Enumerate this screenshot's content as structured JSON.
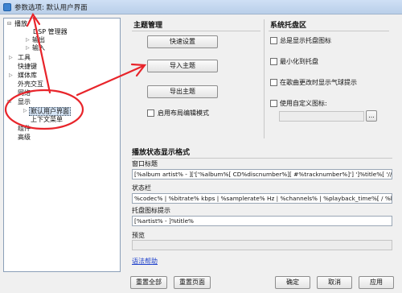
{
  "window": {
    "title": "参数选项: 默认用户界面"
  },
  "tree": {
    "items": [
      {
        "label": "播放",
        "expander": "⊟"
      },
      {
        "label": "DSP 管理器",
        "expander": ""
      },
      {
        "label": "输出",
        "expander": "▷"
      },
      {
        "label": "输入",
        "expander": "▷"
      },
      {
        "label": "工具",
        "expander": "▷"
      },
      {
        "label": "快捷键",
        "expander": ""
      },
      {
        "label": "媒体库",
        "expander": "▷"
      },
      {
        "label": "外壳交互",
        "expander": ""
      },
      {
        "label": "网络",
        "expander": ""
      },
      {
        "label": "显示",
        "expander": "⊟"
      },
      {
        "label": "默认用户界面",
        "expander": "▷"
      },
      {
        "label": "上下文菜单",
        "expander": ""
      },
      {
        "label": "组件",
        "expander": ""
      },
      {
        "label": "高级",
        "expander": ""
      }
    ]
  },
  "theme": {
    "title": "主题管理",
    "quick_setup": "快速设置",
    "import_theme": "导入主题",
    "export_theme": "导出主题",
    "layout_edit_mode": "启用布局编辑模式"
  },
  "tray": {
    "title": "系统托盘区",
    "always_show_icon": "总是显示托盘图标",
    "minimize_to_tray": "最小化到托盘",
    "balloon_on_change": "在歌曲更改时显示气球提示",
    "custom_icon": "使用自定义图标:",
    "browse": "..."
  },
  "format": {
    "title": "播放状态显示格式",
    "window_title_label": "窗口标题",
    "window_title_value": "[%album artist% - ]['['%album%[ CD%discnumber%][ #%tracknumber%]'] ']%title%[ '//' %track a",
    "statusbar_label": "状态栏",
    "statusbar_value": "%codec% | %bitrate% kbps | %samplerate% Hz | %channels% | %playback_time%[ / %length%",
    "tray_tip_label": "托盘图标提示",
    "tray_tip_value": "[%artist% - ]%title%",
    "preview_label": "预览"
  },
  "footer": {
    "help": "语法帮助",
    "reset_all": "重置全部",
    "reset_page": "重置页面",
    "ok": "确定",
    "cancel": "取消",
    "apply": "应用"
  },
  "colors": {
    "annotation_red": "#e8242a"
  }
}
